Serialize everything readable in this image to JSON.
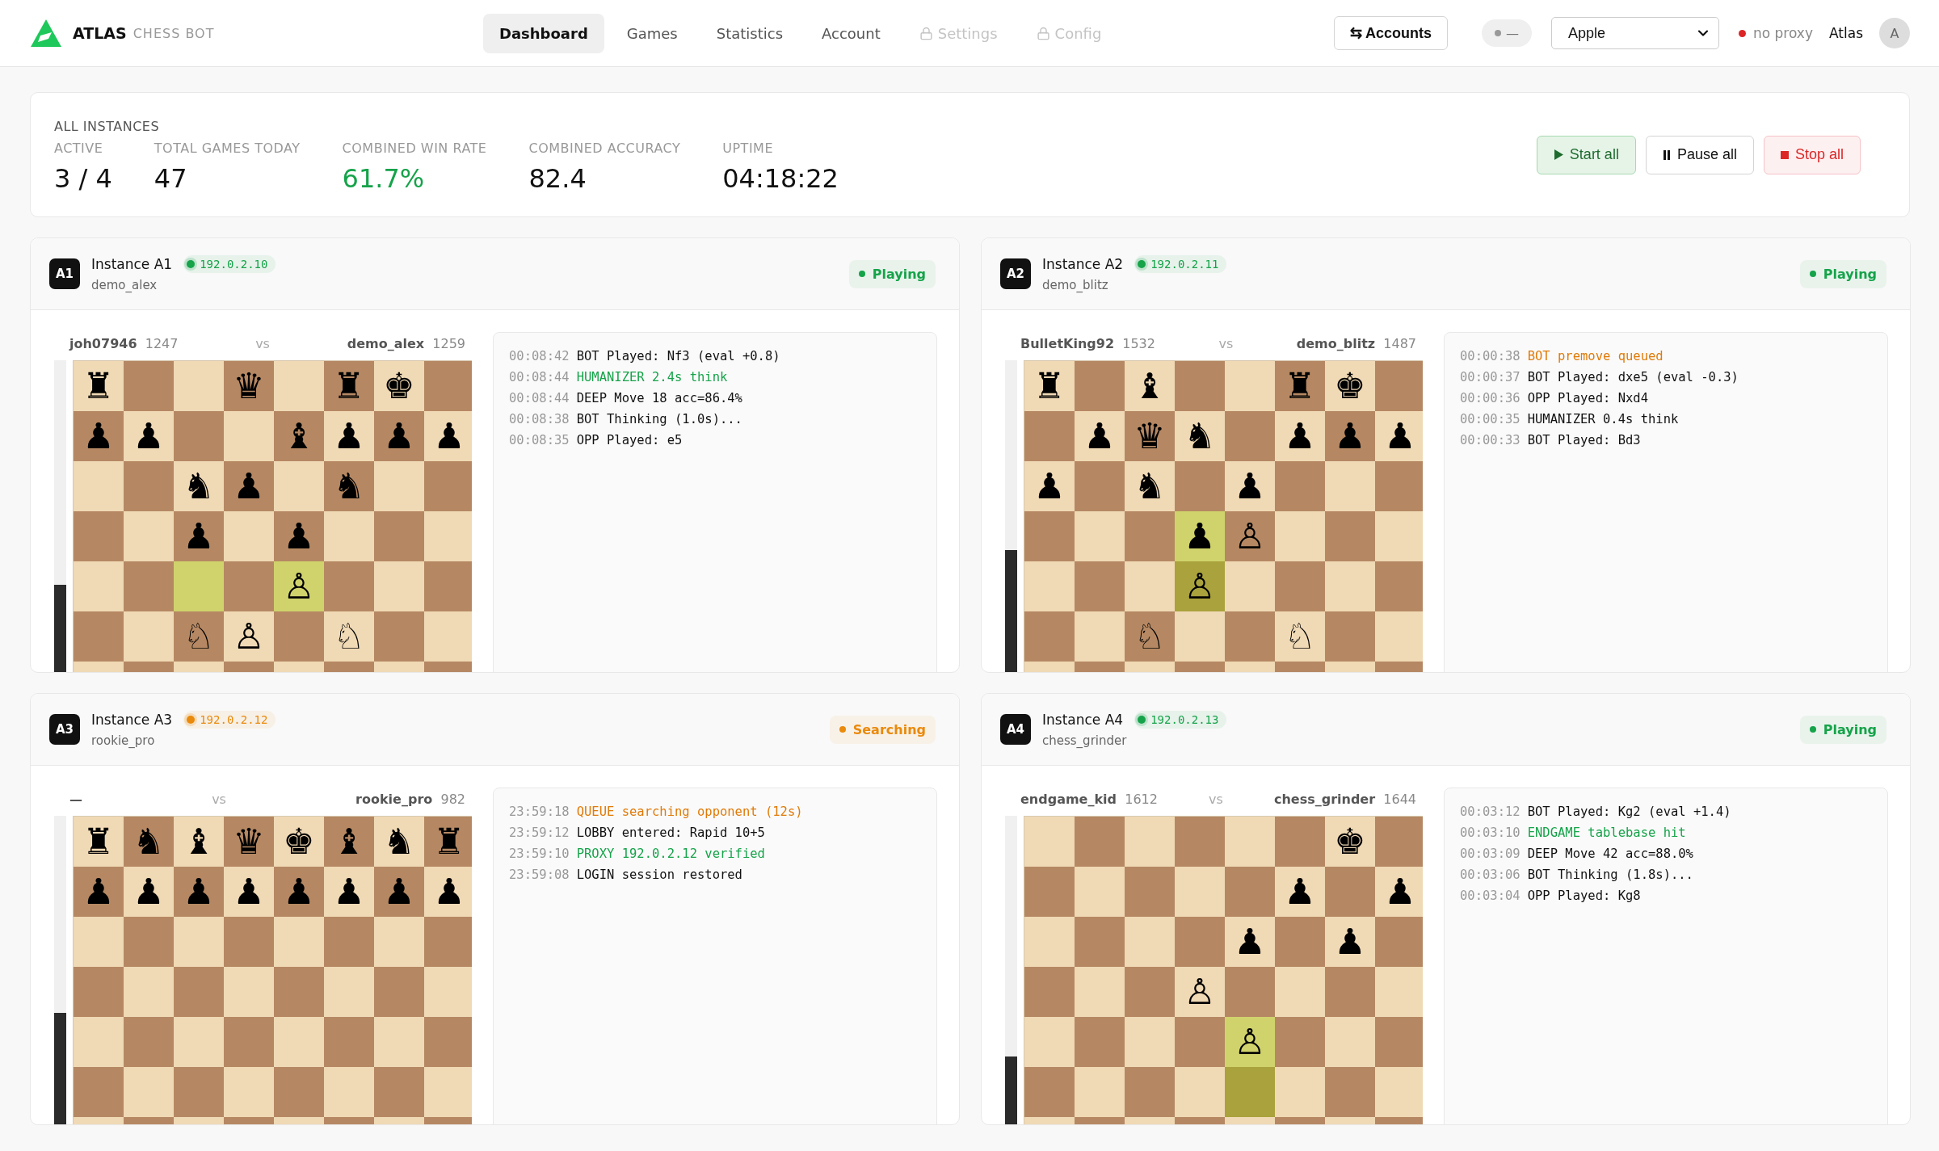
{
  "brand": {
    "name": "ATLAS",
    "tagline": "CHESS BOT"
  },
  "nav": [
    {
      "label": "Dashboard",
      "selected": true,
      "locked": false
    },
    {
      "label": "Games",
      "selected": false,
      "locked": false
    },
    {
      "label": "Statistics",
      "selected": false,
      "locked": false
    },
    {
      "label": "Account",
      "selected": false,
      "locked": false
    },
    {
      "label": "Settings",
      "selected": false,
      "locked": true
    },
    {
      "label": "Config",
      "selected": false,
      "locked": true
    }
  ],
  "header_right": {
    "accounts_button": {
      "glyph": "⇆",
      "label": "Accounts"
    },
    "toggle": {
      "text": "—"
    },
    "account_select": {
      "value": "Apple"
    },
    "proxy": {
      "label": "no proxy",
      "color": "#dc2626"
    },
    "user": "Atlas",
    "avatar": "A"
  },
  "summary": {
    "title": "ALL INSTANCES",
    "stats": [
      {
        "label": "ACTIVE",
        "value": "3 / 4",
        "color": "#111111"
      },
      {
        "label": "TOTAL GAMES TODAY",
        "value": "47",
        "color": "#111111"
      },
      {
        "label": "COMBINED WIN RATE",
        "value": "61.7%",
        "color": "#16a34a"
      },
      {
        "label": "COMBINED ACCURACY",
        "value": "82.4",
        "color": "#111111"
      },
      {
        "label": "UPTIME",
        "value": "04:18:22",
        "color": "#111111"
      }
    ],
    "buttons": [
      {
        "kind": "start",
        "label": "Start all"
      },
      {
        "kind": "pause",
        "label": "Pause all"
      },
      {
        "kind": "stop",
        "label": "Stop all"
      }
    ]
  },
  "instances": [
    {
      "badge": "A1",
      "title": "Instance A1",
      "ip": {
        "text": "192.0.2.10",
        "color": "#16a34a"
      },
      "account": "demo_alex",
      "status": {
        "label": "Playing",
        "color": "#16a34a"
      },
      "players": {
        "left": {
          "name": "joh07946",
          "rating": "1247"
        },
        "vs": "vs",
        "right": {
          "name": "demo_alex",
          "rating": "1259"
        }
      },
      "eval_bar": {
        "level": 0.28
      },
      "board": [
        [
          {
            "piece": "♜",
            "highlighted": false
          },
          {
            "highlighted": false
          },
          {
            "highlighted": false
          },
          {
            "piece": "♛",
            "highlighted": false
          },
          {
            "highlighted": false
          },
          {
            "piece": "♜",
            "highlighted": false
          },
          {
            "piece": "♚",
            "highlighted": false
          },
          {
            "highlighted": false
          }
        ],
        [
          {
            "piece": "♟",
            "highlighted": false
          },
          {
            "piece": "♟",
            "highlighted": false
          },
          {
            "highlighted": false
          },
          {
            "highlighted": false
          },
          {
            "piece": "♝",
            "highlighted": false
          },
          {
            "piece": "♟",
            "highlighted": false
          },
          {
            "piece": "♟",
            "highlighted": false
          },
          {
            "piece": "♟",
            "highlighted": false
          }
        ],
        [
          {
            "highlighted": false
          },
          {
            "highlighted": false
          },
          {
            "piece": "♞",
            "highlighted": false
          },
          {
            "piece": "♟",
            "highlighted": false
          },
          {
            "highlighted": false
          },
          {
            "piece": "♞",
            "highlighted": false
          },
          {
            "highlighted": false
          },
          {
            "highlighted": false
          }
        ],
        [
          {
            "highlighted": false
          },
          {
            "highlighted": false
          },
          {
            "piece": "♟",
            "highlighted": false
          },
          {
            "highlighted": false
          },
          {
            "piece": "♟",
            "highlighted": false
          },
          {
            "highlighted": false
          },
          {
            "highlighted": false
          },
          {
            "highlighted": false
          }
        ],
        [
          {
            "highlighted": false
          },
          {
            "highlighted": false
          },
          {
            "highlighted": true
          },
          {
            "highlighted": false
          },
          {
            "piece": "♙",
            "highlighted": true
          },
          {
            "highlighted": false
          },
          {
            "highlighted": false
          },
          {
            "highlighted": false
          }
        ],
        [
          {
            "highlighted": false
          },
          {
            "highlighted": false
          },
          {
            "piece": "♘",
            "highlighted": false
          },
          {
            "piece": "♙",
            "highlighted": false
          },
          {
            "highlighted": false
          },
          {
            "piece": "♘",
            "highlighted": false
          },
          {
            "highlighted": false
          },
          {
            "highlighted": false
          }
        ]
      ],
      "log": [
        {
          "time": "00:08:42",
          "text": "BOT Played: Nf3 (eval +0.8)",
          "color": "#111111"
        },
        {
          "time": "00:08:44",
          "text": "HUMANIZER 2.4s think",
          "color": "#16a34a"
        },
        {
          "time": "00:08:44",
          "text": "DEEP Move 18 acc=86.4%",
          "color": "#111111"
        },
        {
          "time": "00:08:38",
          "text": "BOT Thinking (1.0s)...",
          "color": "#111111"
        },
        {
          "time": "00:08:35",
          "text": "OPP Played: e5",
          "color": "#111111"
        }
      ]
    },
    {
      "badge": "A2",
      "title": "Instance A2",
      "ip": {
        "text": "192.0.2.11",
        "color": "#16a34a"
      },
      "account": "demo_blitz",
      "status": {
        "label": "Playing",
        "color": "#16a34a"
      },
      "players": {
        "left": {
          "name": "BulletKing92",
          "rating": "1532"
        },
        "vs": "vs",
        "right": {
          "name": "demo_blitz",
          "rating": "1487"
        }
      },
      "eval_bar": {
        "level": 0.39
      },
      "board": [
        [
          {
            "piece": "♜",
            "highlighted": false
          },
          {
            "highlighted": false
          },
          {
            "piece": "♝",
            "highlighted": false
          },
          {
            "highlighted": false
          },
          {
            "highlighted": false
          },
          {
            "piece": "♜",
            "highlighted": false
          },
          {
            "piece": "♚",
            "highlighted": false
          },
          {
            "highlighted": false
          }
        ],
        [
          {
            "highlighted": false
          },
          {
            "piece": "♟",
            "highlighted": false
          },
          {
            "piece": "♛",
            "highlighted": false
          },
          {
            "piece": "♞",
            "highlighted": false
          },
          {
            "highlighted": false
          },
          {
            "piece": "♟",
            "highlighted": false
          },
          {
            "piece": "♟",
            "highlighted": false
          },
          {
            "piece": "♟",
            "highlighted": false
          }
        ],
        [
          {
            "piece": "♟",
            "highlighted": false
          },
          {
            "highlighted": false
          },
          {
            "piece": "♞",
            "highlighted": false
          },
          {
            "highlighted": false
          },
          {
            "piece": "♟",
            "highlighted": false
          },
          {
            "highlighted": false
          },
          {
            "highlighted": false
          },
          {
            "highlighted": false
          }
        ],
        [
          {
            "highlighted": false
          },
          {
            "highlighted": false
          },
          {
            "highlighted": false
          },
          {
            "piece": "♟",
            "highlighted": true
          },
          {
            "piece": "♙",
            "highlighted": false
          },
          {
            "highlighted": false
          },
          {
            "highlighted": false
          },
          {
            "highlighted": false
          }
        ],
        [
          {
            "highlighted": false
          },
          {
            "highlighted": false
          },
          {
            "highlighted": false
          },
          {
            "piece": "♙",
            "highlighted": true
          },
          {
            "highlighted": false
          },
          {
            "highlighted": false
          },
          {
            "highlighted": false
          },
          {
            "highlighted": false
          }
        ],
        [
          {
            "highlighted": false
          },
          {
            "highlighted": false
          },
          {
            "piece": "♘",
            "highlighted": false
          },
          {
            "highlighted": false
          },
          {
            "highlighted": false
          },
          {
            "piece": "♘",
            "highlighted": false
          },
          {
            "highlighted": false
          },
          {
            "highlighted": false
          }
        ]
      ],
      "log": [
        {
          "time": "00:00:38",
          "text": "BOT premove queued",
          "color": "#e07b0a"
        },
        {
          "time": "00:00:37",
          "text": "BOT Played: dxe5 (eval -0.3)",
          "color": "#111111"
        },
        {
          "time": "00:00:36",
          "text": "OPP Played: Nxd4",
          "color": "#111111"
        },
        {
          "time": "00:00:35",
          "text": "HUMANIZER 0.4s think",
          "color": "#111111"
        },
        {
          "time": "00:00:33",
          "text": "BOT Played: Bd3",
          "color": "#111111"
        }
      ]
    },
    {
      "badge": "A3",
      "title": "Instance A3",
      "ip": {
        "text": "192.0.2.12",
        "color": "#ea8a0c"
      },
      "account": "rookie_pro",
      "status": {
        "label": "Searching",
        "color": "#ea8a0c"
      },
      "players": {
        "left": {
          "name": "—"
        },
        "vs": "vs",
        "right": {
          "name": "rookie_pro",
          "rating": "982"
        }
      },
      "eval_bar": {
        "level": 0.36
      },
      "board": [
        [
          {
            "piece": "♜",
            "highlighted": false
          },
          {
            "piece": "♞",
            "highlighted": false
          },
          {
            "piece": "♝",
            "highlighted": false
          },
          {
            "piece": "♛",
            "highlighted": false
          },
          {
            "piece": "♚",
            "highlighted": false
          },
          {
            "piece": "♝",
            "highlighted": false
          },
          {
            "piece": "♞",
            "highlighted": false
          },
          {
            "piece": "♜",
            "highlighted": false
          }
        ],
        [
          {
            "piece": "♟",
            "highlighted": false
          },
          {
            "piece": "♟",
            "highlighted": false
          },
          {
            "piece": "♟",
            "highlighted": false
          },
          {
            "piece": "♟",
            "highlighted": false
          },
          {
            "piece": "♟",
            "highlighted": false
          },
          {
            "piece": "♟",
            "highlighted": false
          },
          {
            "piece": "♟",
            "highlighted": false
          },
          {
            "piece": "♟",
            "highlighted": false
          }
        ],
        [
          {
            "highlighted": false
          },
          {
            "highlighted": false
          },
          {
            "highlighted": false
          },
          {
            "highlighted": false
          },
          {
            "highlighted": false
          },
          {
            "highlighted": false
          },
          {
            "highlighted": false
          },
          {
            "highlighted": false
          }
        ],
        [
          {
            "highlighted": false
          },
          {
            "highlighted": false
          },
          {
            "highlighted": false
          },
          {
            "highlighted": false
          },
          {
            "highlighted": false
          },
          {
            "highlighted": false
          },
          {
            "highlighted": false
          },
          {
            "highlighted": false
          }
        ],
        [
          {
            "highlighted": false
          },
          {
            "highlighted": false
          },
          {
            "highlighted": false
          },
          {
            "highlighted": false
          },
          {
            "highlighted": false
          },
          {
            "highlighted": false
          },
          {
            "highlighted": false
          },
          {
            "highlighted": false
          }
        ],
        [
          {
            "highlighted": false
          },
          {
            "highlighted": false
          },
          {
            "highlighted": false
          },
          {
            "highlighted": false
          },
          {
            "highlighted": false
          },
          {
            "highlighted": false
          },
          {
            "highlighted": false
          },
          {
            "highlighted": false
          }
        ]
      ],
      "log": [
        {
          "time": "23:59:18",
          "text": "QUEUE searching opponent (12s)",
          "color": "#e07b0a"
        },
        {
          "time": "23:59:12",
          "text": "LOBBY entered: Rapid 10+5",
          "color": "#111111"
        },
        {
          "time": "23:59:10",
          "text": "PROXY 192.0.2.12 verified",
          "color": "#16a34a"
        },
        {
          "time": "23:59:08",
          "text": "LOGIN session restored",
          "color": "#111111"
        }
      ]
    },
    {
      "badge": "A4",
      "title": "Instance A4",
      "ip": {
        "text": "192.0.2.13",
        "color": "#16a34a"
      },
      "account": "chess_grinder",
      "status": {
        "label": "Playing",
        "color": "#16a34a"
      },
      "players": {
        "left": {
          "name": "endgame_kid",
          "rating": "1612"
        },
        "vs": "vs",
        "right": {
          "name": "chess_grinder",
          "rating": "1644"
        }
      },
      "eval_bar": {
        "level": 0.22
      },
      "board": [
        [
          {
            "highlighted": false
          },
          {
            "highlighted": false
          },
          {
            "highlighted": false
          },
          {
            "highlighted": false
          },
          {
            "highlighted": false
          },
          {
            "highlighted": false
          },
          {
            "piece": "♚",
            "highlighted": false
          },
          {
            "highlighted": false
          }
        ],
        [
          {
            "highlighted": false
          },
          {
            "highlighted": false
          },
          {
            "highlighted": false
          },
          {
            "highlighted": false
          },
          {
            "highlighted": false
          },
          {
            "piece": "♟",
            "highlighted": false
          },
          {
            "highlighted": false
          },
          {
            "piece": "♟",
            "highlighted": false
          }
        ],
        [
          {
            "highlighted": false
          },
          {
            "highlighted": false
          },
          {
            "highlighted": false
          },
          {
            "highlighted": false
          },
          {
            "piece": "♟",
            "highlighted": false
          },
          {
            "highlighted": false
          },
          {
            "piece": "♟",
            "highlighted": false
          },
          {
            "highlighted": false
          }
        ],
        [
          {
            "highlighted": false
          },
          {
            "highlighted": false
          },
          {
            "highlighted": false
          },
          {
            "piece": "♙",
            "highlighted": false
          },
          {
            "highlighted": false
          },
          {
            "highlighted": false
          },
          {
            "highlighted": false
          },
          {
            "highlighted": false
          }
        ],
        [
          {
            "highlighted": false
          },
          {
            "highlighted": false
          },
          {
            "highlighted": false
          },
          {
            "highlighted": false
          },
          {
            "piece": "♙",
            "highlighted": true
          },
          {
            "highlighted": false
          },
          {
            "highlighted": false
          },
          {
            "highlighted": false
          }
        ],
        [
          {
            "highlighted": false
          },
          {
            "highlighted": false
          },
          {
            "highlighted": false
          },
          {
            "highlighted": false
          },
          {
            "highlighted": true
          },
          {
            "highlighted": false
          },
          {
            "highlighted": false
          },
          {
            "highlighted": false
          }
        ]
      ],
      "log": [
        {
          "time": "00:03:12",
          "text": "BOT Played: Kg2 (eval +1.4)",
          "color": "#111111"
        },
        {
          "time": "00:03:10",
          "text": "ENDGAME tablebase hit",
          "color": "#16a34a"
        },
        {
          "time": "00:03:09",
          "text": "DEEP Move 42 acc=88.0%",
          "color": "#111111"
        },
        {
          "time": "00:03:06",
          "text": "BOT Thinking (1.8s)...",
          "color": "#111111"
        },
        {
          "time": "00:03:04",
          "text": "OPP Played: Kg8",
          "color": "#111111"
        }
      ]
    }
  ]
}
